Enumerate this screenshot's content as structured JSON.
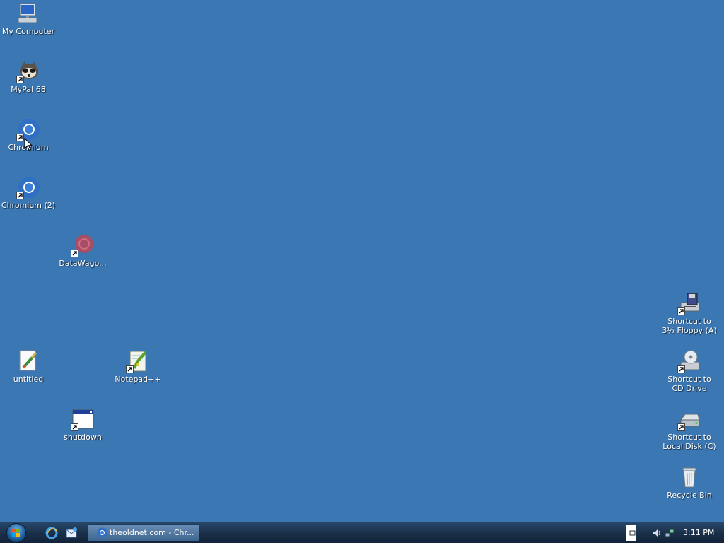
{
  "desktop": {
    "background_color": "#3b77b3",
    "icons": {
      "my_computer": "My Computer",
      "mypal": "MyPal 68",
      "chromium": "Chromium",
      "chromium2": "Chromium (2)",
      "datawagon": "DataWago...",
      "untitled": "untitled",
      "notepadpp": "Notepad++",
      "shutdown": "shutdown",
      "floppy_line1": "Shortcut to",
      "floppy_line2": "3½ Floppy (A)",
      "cd_line1": "Shortcut to",
      "cd_line2": "CD Drive",
      "localdisk_line1": "Shortcut to",
      "localdisk_line2": "Local Disk (C)",
      "recycle": "Recycle Bin"
    }
  },
  "taskbar": {
    "start_icon": "windows-start-orb",
    "quick_launch": [
      "internet-explorer-icon",
      "outlook-express-icon"
    ],
    "task_button": "theoldnet.com - Chr...",
    "tray_icons": [
      "volume-icon",
      "network-icon"
    ],
    "clock": "3:11 PM"
  }
}
